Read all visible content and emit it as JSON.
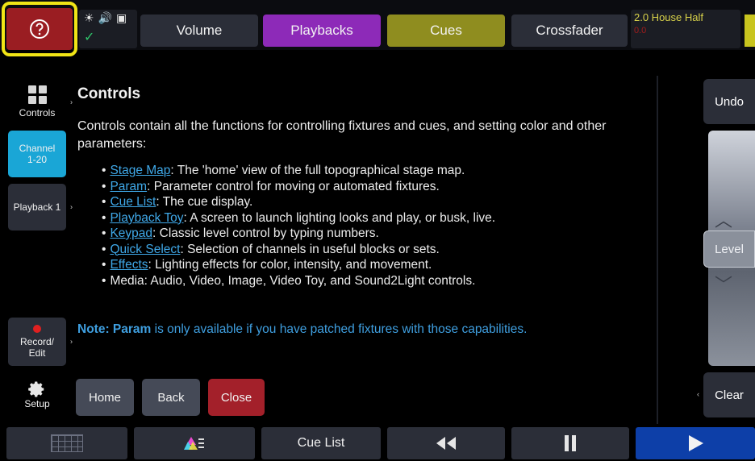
{
  "topbar": {
    "help_icon": "question-circle-icon",
    "status_icons": [
      "sun-icon",
      "speaker-icon",
      "monitor-icon"
    ],
    "status_ok_icon": "checkmark-icon",
    "tabs": [
      {
        "label": "Volume",
        "color": "#2b2e38"
      },
      {
        "label": "Playbacks",
        "color": "#8d2ab8"
      },
      {
        "label": "Cues",
        "color": "#8f8d1f"
      },
      {
        "label": "Crossfader",
        "color": "#2b2e38"
      }
    ],
    "house": {
      "label": "2.0 House Half",
      "value": "0.0"
    }
  },
  "sidebar": {
    "items": [
      {
        "label": "Controls",
        "icon": "grid-icon"
      },
      {
        "label": "Channel 1-20"
      },
      {
        "label": "Playback 1"
      },
      {
        "label": "Record/ Edit",
        "icon": "record-dot-icon"
      },
      {
        "label": "Setup",
        "icon": "gear-icon"
      }
    ]
  },
  "help": {
    "title": "Controls",
    "intro": "Controls contain all the functions for controlling fixtures and cues, and setting color and other parameters:",
    "bullets": [
      {
        "link": "Stage Map",
        "text": ": The 'home' view of the full topographical stage map."
      },
      {
        "link": "Param",
        "text": ": Parameter control for moving or automated fixtures."
      },
      {
        "link": "Cue List",
        "text": ": The cue display."
      },
      {
        "link": "Playback Toy",
        "text": ": A screen to launch lighting looks and play, or busk, live."
      },
      {
        "link": "Keypad",
        "text": ": Classic level control by typing numbers."
      },
      {
        "link": "Quick Select",
        "text": ": Selection of channels in useful blocks or sets."
      },
      {
        "link": "Effects",
        "text": ": Lighting effects for color, intensity, and movement."
      },
      {
        "link": "",
        "text": "Media: Audio, Video, Image, Video Toy, and Sound2Light controls."
      }
    ],
    "note_bold": "Note: Param",
    "note_text": " is only available if you have patched fixtures with those capabilities.",
    "buttons": {
      "home": "Home",
      "back": "Back",
      "close": "Close"
    }
  },
  "right_panel": {
    "undo": "Undo",
    "level": "Level",
    "clear": "Clear"
  },
  "bottombar": {
    "keypad_icon": "keypad-grid-icon",
    "color_icon": "color-picker-icon",
    "cue_list": "Cue List",
    "rewind_icon": "rewind-icon",
    "pause_icon": "pause-icon",
    "play_icon": "play-icon"
  }
}
